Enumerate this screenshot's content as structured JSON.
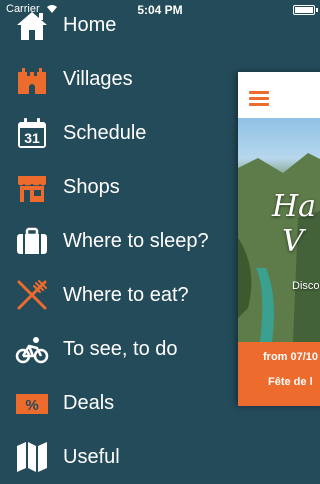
{
  "status_bar": {
    "carrier": "Carrier",
    "time": "5:04 PM"
  },
  "menu": {
    "items": [
      {
        "label": "Home",
        "icon": "home-icon"
      },
      {
        "label": "Villages",
        "icon": "castle-icon"
      },
      {
        "label": "Schedule",
        "icon": "calendar-icon",
        "calendar_day": "31"
      },
      {
        "label": "Shops",
        "icon": "shop-icon"
      },
      {
        "label": "Where to sleep?",
        "icon": "suitcase-icon"
      },
      {
        "label": "Where to eat?",
        "icon": "fork-knife-icon"
      },
      {
        "label": "To see, to do",
        "icon": "bicycle-icon"
      },
      {
        "label": "Deals",
        "icon": "percent-tag-icon",
        "tag_text": "%"
      },
      {
        "label": "Useful",
        "icon": "map-icon"
      }
    ]
  },
  "content_panel": {
    "hero_title_line1": "Ha",
    "hero_title_line2": "V",
    "hero_subtitle": "Disco",
    "event_date": "from 07/10",
    "event_name": "Fête de l"
  },
  "colors": {
    "background": "#244b5a",
    "accent": "#ee6b2e",
    "text": "#ffffff"
  }
}
